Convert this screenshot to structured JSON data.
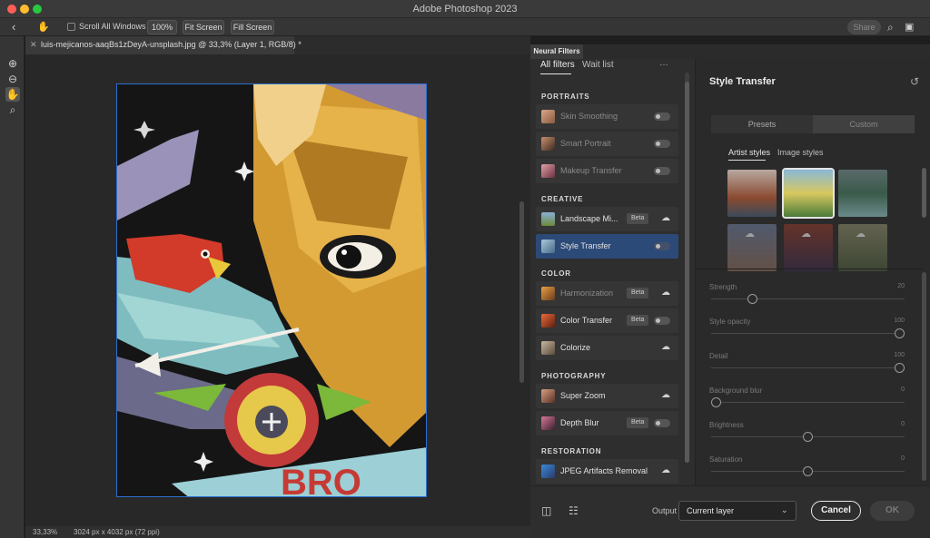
{
  "window": {
    "title": "Adobe Photoshop 2023"
  },
  "options_bar": {
    "back_icon": "chevron-left-icon",
    "hand_icon": "hand-icon",
    "scroll_all_label": "Scroll All Windows",
    "zoom_label": "100%",
    "fit_screen_label": "Fit Screen",
    "fill_screen_label": "Fill Screen",
    "share_label": "Share"
  },
  "document": {
    "tab_title": "luis-mejicanos-aaqBs1zDeyA-unsplash.jpg @ 33,3% (Layer 1, RGB/8) *",
    "zoom": "33,33%",
    "dimensions": "3024 px x 4032 px (72 ppi)"
  },
  "neural_filters": {
    "panel_title": "Neural Filters",
    "tabs": [
      "All filters",
      "Wait list"
    ],
    "sections": [
      {
        "name": "PORTRAITS",
        "items": [
          {
            "label": "Skin Smoothing",
            "state": "toggle"
          },
          {
            "label": "Smart Portrait",
            "state": "toggle"
          },
          {
            "label": "Makeup Transfer",
            "state": "toggle"
          }
        ]
      },
      {
        "name": "CREATIVE",
        "items": [
          {
            "label": "Landscape Mi...",
            "badge": "Beta",
            "state": "cloud"
          },
          {
            "label": "Style Transfer",
            "state": "toggle"
          }
        ]
      },
      {
        "name": "COLOR",
        "items": [
          {
            "label": "Harmonization",
            "badge": "Beta",
            "state": "cloud"
          },
          {
            "label": "Color Transfer",
            "badge": "Beta",
            "state": "toggle"
          },
          {
            "label": "Colorize",
            "state": "cloud"
          }
        ]
      },
      {
        "name": "PHOTOGRAPHY",
        "items": [
          {
            "label": "Super Zoom",
            "state": "cloud"
          },
          {
            "label": "Depth Blur",
            "badge": "Beta",
            "state": "toggle"
          }
        ]
      },
      {
        "name": "RESTORATION",
        "items": [
          {
            "label": "JPEG Artifacts Removal",
            "state": "cloud"
          }
        ]
      }
    ],
    "output_label": "Output",
    "output_value": "Current layer",
    "cancel_label": "Cancel",
    "ok_label": "OK"
  },
  "style_transfer": {
    "title": "Style Transfer",
    "segments": [
      "Presets",
      "Custom"
    ],
    "subtabs": [
      "Artist styles",
      "Image styles"
    ],
    "sliders": [
      {
        "label": "Strength",
        "value": "20",
        "fraction": 0.2
      },
      {
        "label": "Style opacity",
        "value": "100",
        "fraction": 1.0
      },
      {
        "label": "Detail",
        "value": "100",
        "fraction": 1.0
      },
      {
        "label": "Background blur",
        "value": "0",
        "fraction": 0.0
      },
      {
        "label": "Brightness",
        "value": "0",
        "fraction": 0.5
      },
      {
        "label": "Saturation",
        "value": "0",
        "fraction": 0.5
      }
    ]
  },
  "colors": {
    "accent_selection": "#2c4a78",
    "canvas_border": "#2d6fd0"
  }
}
